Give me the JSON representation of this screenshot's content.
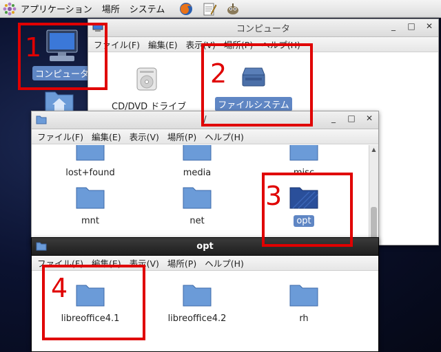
{
  "panel": {
    "menus": [
      "アプリケーション",
      "場所",
      "システム"
    ],
    "launchers": [
      "firefox-icon",
      "text-editor-icon",
      "gimp-icon"
    ]
  },
  "desktop": {
    "computer_label": "コンピュータ",
    "home_icon": "home-folder-icon"
  },
  "computer_window": {
    "title": "コンピュータ",
    "menus": [
      "ファイル(F)",
      "編集(E)",
      "表示(V)",
      "場所(P)",
      "ヘルプ(H)"
    ],
    "items": [
      {
        "label": "CD/DVD ドライブ",
        "icon": "cd-drive-icon"
      },
      {
        "label": "ファイルシステム",
        "icon": "harddisk-icon",
        "selected": true
      }
    ]
  },
  "root_window": {
    "title": "/",
    "menus": [
      "ファイル(F)",
      "編集(E)",
      "表示(V)",
      "場所(P)",
      "ヘルプ(H)"
    ],
    "items_row1": [
      "lost+found",
      "media",
      "misc"
    ],
    "items_row2": [
      "mnt",
      "net",
      "opt"
    ],
    "selected": "opt"
  },
  "opt_window": {
    "title": "opt",
    "menus": [
      "ファイル(F)",
      "編集(E)",
      "表示(V)",
      "場所(P)",
      "ヘルプ(H)"
    ],
    "items": [
      "libreoffice4.1",
      "libreoffice4.2",
      "rh"
    ]
  },
  "window_controls": {
    "minimize": "_",
    "maximize": "□",
    "close": "✕"
  },
  "annotations": [
    "1",
    "2",
    "3",
    "4"
  ],
  "colors": {
    "annotation": "#e00000",
    "selection": "#5f86c4",
    "folder": "#6b9bd8"
  }
}
